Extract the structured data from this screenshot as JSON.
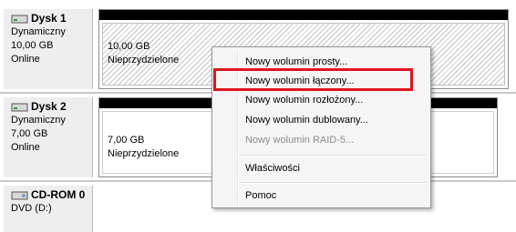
{
  "disks": [
    {
      "name": "Dysk 1",
      "type": "Dynamiczny",
      "size": "10,00 GB",
      "status": "Online",
      "partition": {
        "size": "10,00 GB",
        "state": "Nieprzydzielone"
      }
    },
    {
      "name": "Dysk 2",
      "type": "Dynamiczny",
      "size": "7,00 GB",
      "status": "Online",
      "partition": {
        "size": "7,00 GB",
        "state": "Nieprzydzielone"
      }
    },
    {
      "name": "CD-ROM 0",
      "type": "DVD (D:)"
    }
  ],
  "context_menu": {
    "items": [
      {
        "label": "Nowy wolumin prosty...",
        "enabled": true
      },
      {
        "label": "Nowy wolumin łączony...",
        "enabled": true,
        "highlighted": true
      },
      {
        "label": "Nowy wolumin rozłożony...",
        "enabled": true
      },
      {
        "label": "Nowy wolumin dublowany...",
        "enabled": true
      },
      {
        "label": "Nowy wolumin RAID-5...",
        "enabled": false
      },
      {
        "label": "Właściwości",
        "enabled": true
      },
      {
        "label": "Pomoc",
        "enabled": true
      }
    ]
  },
  "colors": {
    "highlight_border": "#e0141e",
    "partition_header": "#000000"
  }
}
